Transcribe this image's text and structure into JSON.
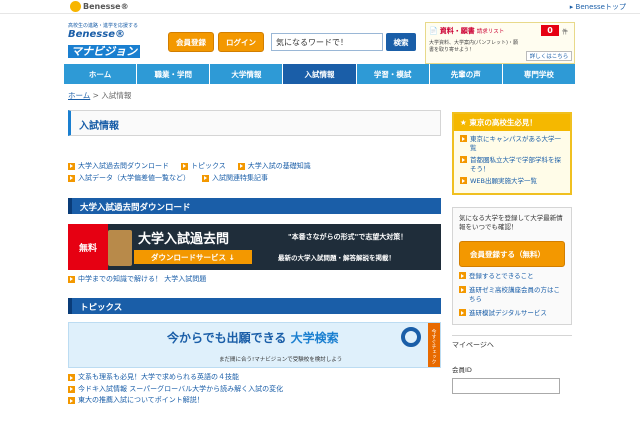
{
  "topbar": {
    "logo": "Benesse®",
    "trail": "▸ Benesseトップ"
  },
  "brand": {
    "tagline": "高校生の進路・進学を応援する",
    "name1": "Benesse®",
    "name2": "マナビジョン"
  },
  "header": {
    "register_label": "会員登録",
    "login_label": "ログイン",
    "search_value": "気になるワードで！",
    "search_button": "検索",
    "doc_title": "資料・願書",
    "doc_sub": "請求リスト",
    "doc_count": "0",
    "doc_unit": "件",
    "doc_note": "大学資料、大学案内(パンフレット)・願書を取り寄せよう！",
    "doc_view": "詳しくはこちら"
  },
  "nav": [
    "ホーム",
    "職業・学問",
    "大学情報",
    "入試情報",
    "学習・模試",
    "先輩の声",
    "専門学校"
  ],
  "nav_active": 3,
  "breadcrumb": {
    "home": "ホーム",
    "sep": ">",
    "current": "入試情報"
  },
  "page_title": "入試情報",
  "quick_links": [
    [
      "大学入試過去問ダウンロード",
      "トピックス",
      "大学入試の基礎知識"
    ],
    [
      "入試データ（大学偏差値一覧など）",
      "入試関連特集記事"
    ]
  ],
  "section1": {
    "heading": "大学入試過去問ダウンロード",
    "banner": {
      "badge": "無料",
      "title": "大学入試過去問",
      "sub": "ダウンロードサービス ↓",
      "catch1": "\"本番さながらの形式\"で志望大対策！",
      "catch2": "最新の大学入試問題・解答解説を掲載！"
    },
    "link": "中学までの知識で解ける！ 大学入試問題"
  },
  "section2": {
    "heading": "トピックス",
    "banner": {
      "title_a": "今からでも出願できる",
      "title_b": "大学検索",
      "sub": "まだ間に合う!マナビジョンで受験校を検討しよう",
      "check": "今すぐチェック"
    },
    "links": [
      "文系も理系も必見！大学で求められる英語の４技能",
      "今ドキ入試情報 スーパーグローバル大学から読み解く入試の変化",
      "東大の推薦入試についてポイント解説！"
    ]
  },
  "sidebar": {
    "tokyo_title": "東京の高校生必見！",
    "tokyo_links": [
      "東京にキャンパスがある大学一覧",
      "首都圏私立大学で学部学科を探そう！",
      "WEB出願実施大学一覧"
    ],
    "join_intro": "気になる大学を登録して大学最新情報をいつでも確認！",
    "join_button": "会員登録する（無料）",
    "join_links": [
      "登録するとできること",
      "進研ゼミ高校講座会員の方はこちら",
      "進研模試デジタルサービス"
    ],
    "mypage_title": "マイページへ",
    "member_id_label": "会員ID"
  },
  "colors": {
    "primary": "#1a5ea8",
    "nav": "#2e9ad6",
    "accent": "#f39800",
    "yellow": "#f5b800"
  }
}
